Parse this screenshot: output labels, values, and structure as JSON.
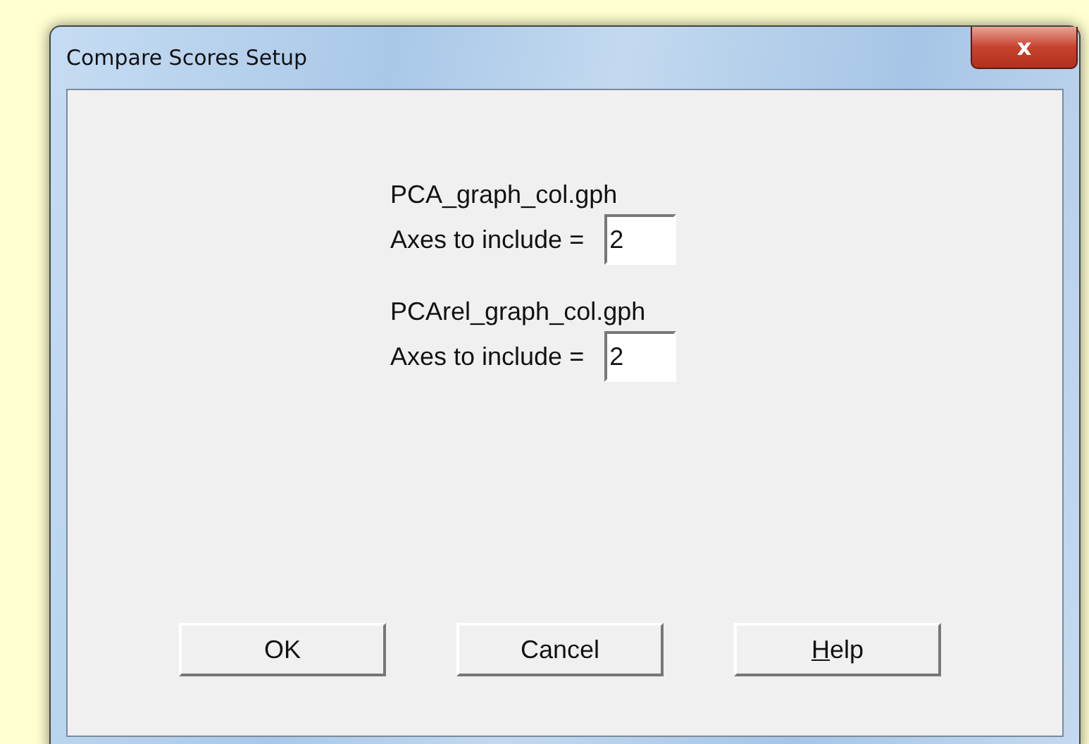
{
  "window": {
    "title": "Compare Scores Setup",
    "close_label": "x"
  },
  "files": [
    {
      "name": "PCA_graph_col.gph",
      "axes_label": "Axes to include =",
      "axes_value": "2"
    },
    {
      "name": "PCArel_graph_col.gph",
      "axes_label": "Axes to include =",
      "axes_value": "2"
    }
  ],
  "buttons": [
    {
      "label": "OK",
      "accelerator": false
    },
    {
      "label": "Cancel",
      "accelerator": false
    },
    {
      "label": "Help",
      "accelerator": true
    }
  ]
}
